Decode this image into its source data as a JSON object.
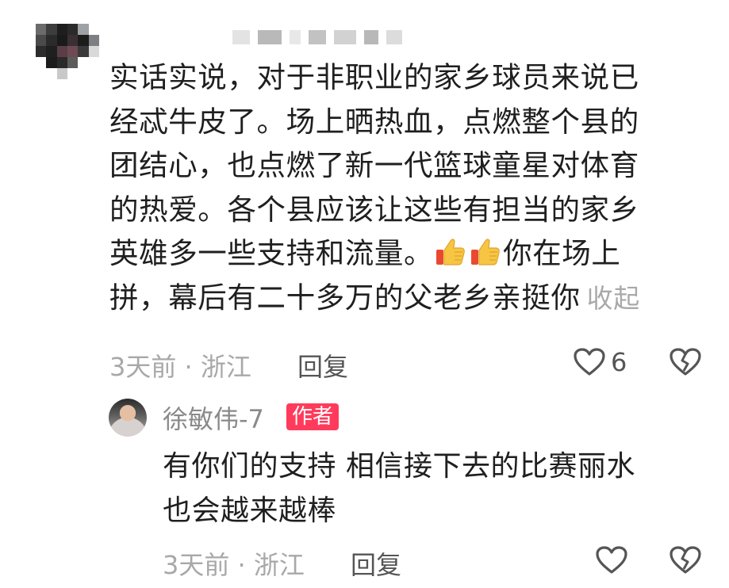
{
  "comment": {
    "text_lines": [
      "实话实说，对于非职业的家乡球员来说已",
      "经忒牛皮了。场上晒热血，点燃整个县的",
      "团结心，也点燃了新一代篮球童星对体育",
      "的热爱。各个县应该让这些有担当的家乡"
    ],
    "line5_before": "英雄多一些支持和流量。",
    "line5_after": "你在场上",
    "line6": "拼，幕后有二十多万的父老乡亲挺你",
    "collapse_label": "收起",
    "meta": "3天前 · 浙江",
    "reply_label": "回复",
    "like_count": "6",
    "emoji": "thumbs-up-icon"
  },
  "reply": {
    "author_name": "徐敏伟-7",
    "author_badge": "作者",
    "text_lines": [
      "有你们的支持 相信接下去的比赛丽水",
      "也会越来越棒"
    ],
    "meta": "3天前 · 浙江",
    "reply_label": "回复"
  },
  "colors": {
    "badge": "#ff3b5c",
    "meta_gray": "#a8a8a8",
    "text": "#1f1f1f"
  }
}
